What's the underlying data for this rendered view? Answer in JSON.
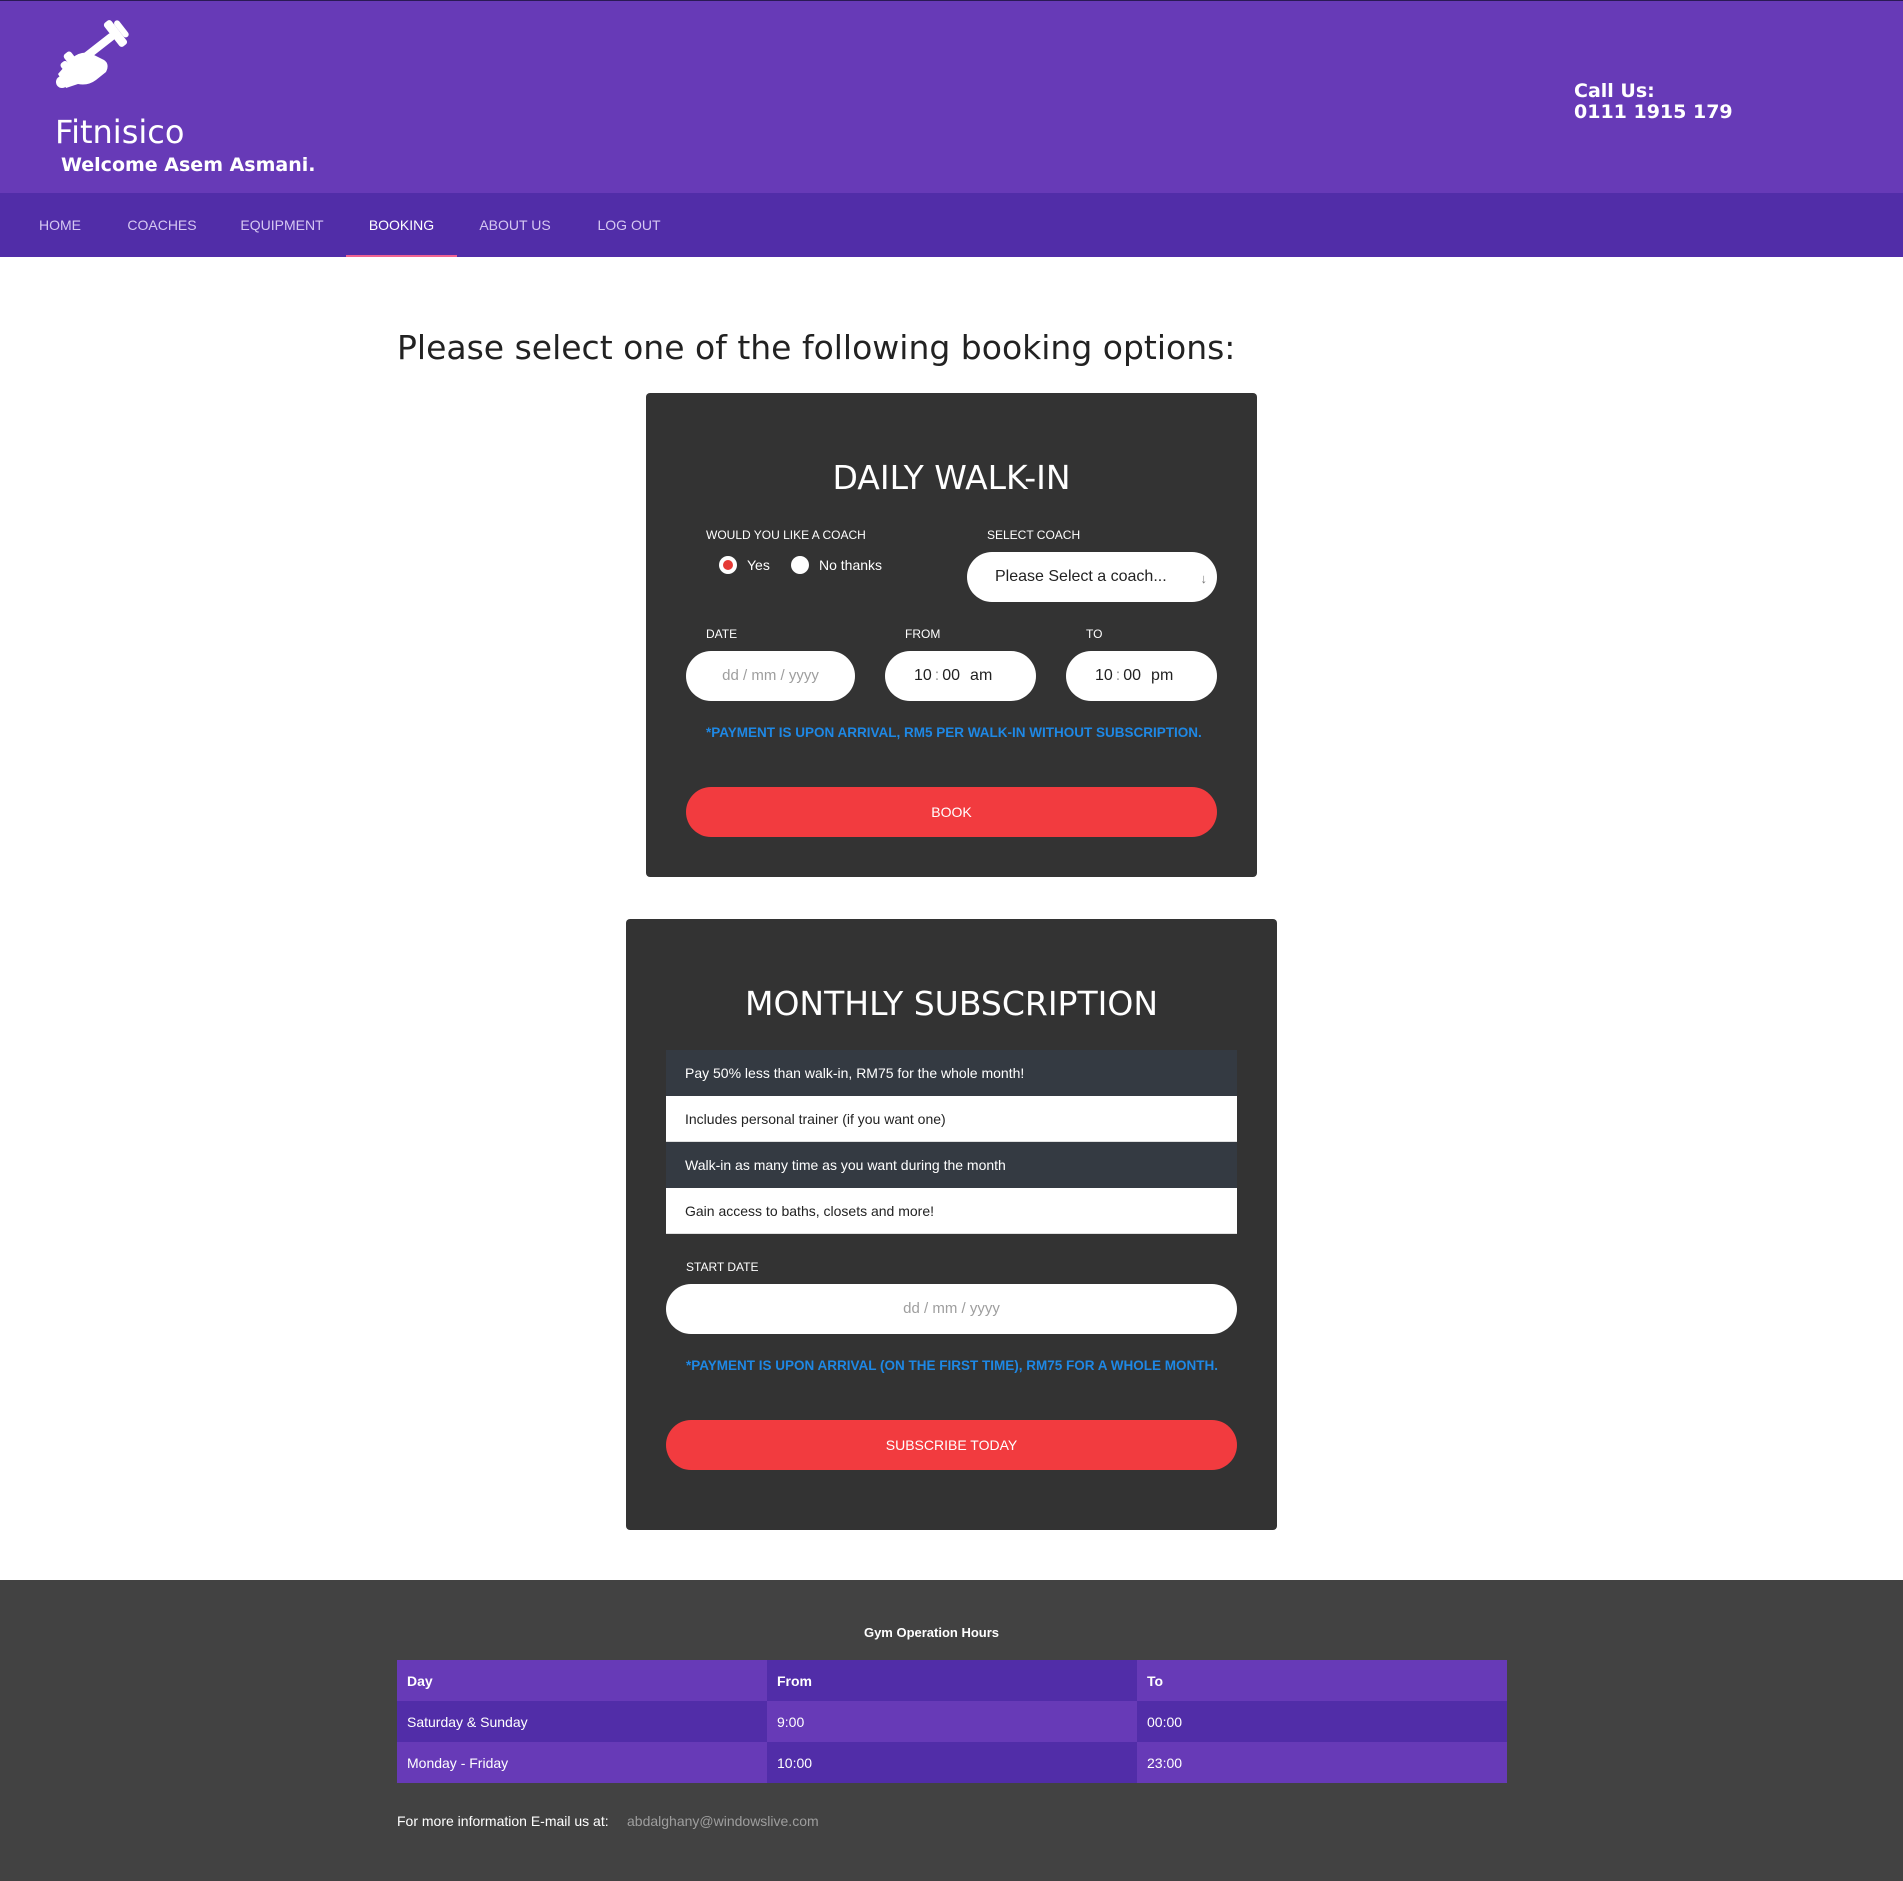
{
  "header": {
    "brand": "Fitnisico",
    "welcome": "Welcome Asem Asmani.",
    "call_label": "Call Us:",
    "call_number": "0111 1915 179",
    "logo_icon": "dumbbell-hand-icon",
    "colors": {
      "header_bg": "#673ab7",
      "nav_bg": "#512da8",
      "active_underline": "#f06292"
    }
  },
  "nav": {
    "items": [
      {
        "label": "HOME"
      },
      {
        "label": "COACHES"
      },
      {
        "label": "EQUIPMENT"
      },
      {
        "label": "BOOKING",
        "active": true
      },
      {
        "label": "ABOUT US"
      },
      {
        "label": "LOG OUT"
      }
    ]
  },
  "main": {
    "title": "Please select one of the following booking options:"
  },
  "walkin": {
    "title": "DAILY WALK-IN",
    "coach_question": "WOULD YOU LIKE A COACH",
    "radio_yes": "Yes",
    "radio_no": "No thanks",
    "radio_selected": "Yes",
    "select_coach_label": "SELECT COACH",
    "select_coach_value": "Please Select a coach...",
    "date_label": "DATE",
    "date_placeholder": "dd / mm / yyyy",
    "from_label": "FROM",
    "from_hour": "10",
    "from_min": "00",
    "from_ampm": "am",
    "to_label": "TO",
    "to_hour": "10",
    "to_min": "00",
    "to_ampm": "pm",
    "note": "*Payment is upon arrival, RM5 per walk-in without subscription.",
    "book_label": "BOOK"
  },
  "subscription": {
    "title": "MONTHLY SUBSCRIPTION",
    "features": [
      "Pay 50% less than walk-in, RM75 for the whole month!",
      "Includes personal trainer (if you want one)",
      "Walk-in as many time as you want during the month",
      "Gain access to baths, closets and more!"
    ],
    "start_date_label": "START DATE",
    "start_date_placeholder": "dd / mm / yyyy",
    "note": "*Payment is upon arrival (on the first time), RM75 for a whole month.",
    "subscribe_label": "SUBSCRIBE TODAY",
    "colors": {
      "button": "#f23b3f",
      "note": "#1e88e5",
      "card_bg": "#333333"
    }
  },
  "footer": {
    "title": "Gym Operation Hours",
    "headers": [
      "Day",
      "From",
      "To"
    ],
    "rows": [
      [
        "Saturday & Sunday",
        "9:00",
        "00:00"
      ],
      [
        "Monday - Friday",
        "10:00",
        "23:00"
      ]
    ],
    "email_label": "For more information E-mail us at:",
    "email": "abdalghany@windowslive.com"
  }
}
